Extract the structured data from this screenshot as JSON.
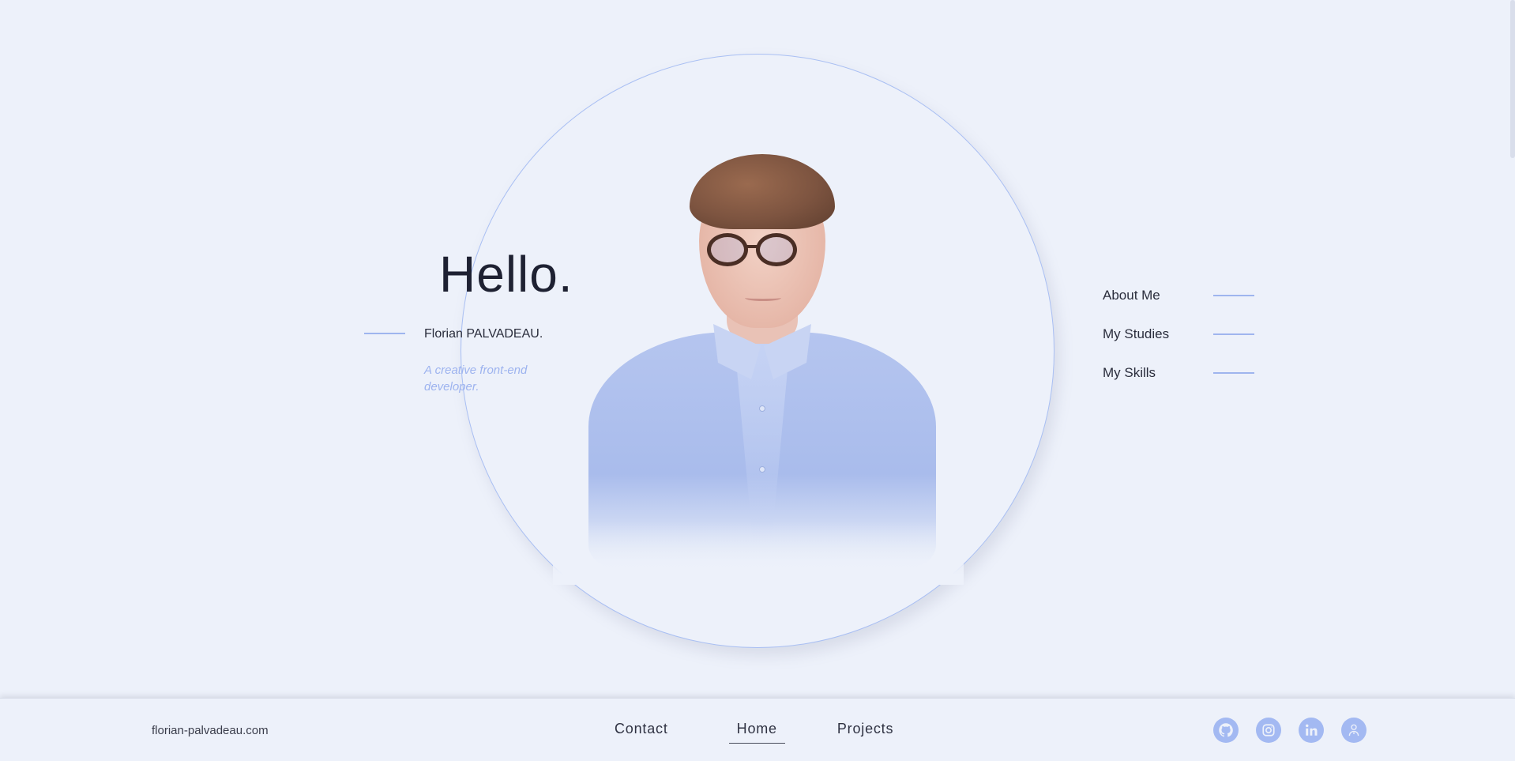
{
  "hero": {
    "greeting": "Hello.",
    "name": "Florian PALVADEAU.",
    "tagline": "A creative front-end developer."
  },
  "side_nav": {
    "items": [
      {
        "label": "About Me"
      },
      {
        "label": "My Studies"
      },
      {
        "label": "My Skills"
      }
    ]
  },
  "footer": {
    "domain": "florian-palvadeau.com",
    "nav": [
      {
        "label": "Contact",
        "active": false
      },
      {
        "label": "Home",
        "active": true
      },
      {
        "label": "Projects",
        "active": false
      }
    ],
    "socials": [
      {
        "icon": "github-icon"
      },
      {
        "icon": "instagram-icon"
      },
      {
        "icon": "linkedin-icon"
      },
      {
        "icon": "user-profile-icon"
      }
    ]
  },
  "colors": {
    "background": "#edf1fa",
    "accent": "#9fb5ee",
    "text": "#1e2132",
    "social_bg": "#a3b9f2"
  }
}
